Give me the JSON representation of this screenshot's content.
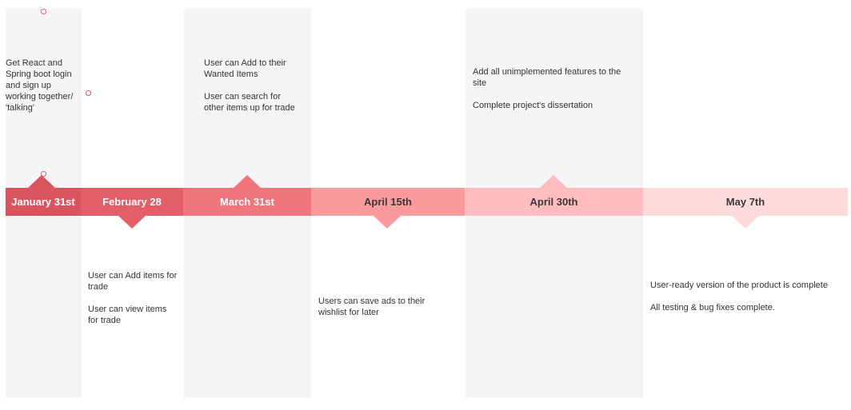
{
  "milestones": [
    {
      "label": "January 31st",
      "color": "#d9545e",
      "notes_above": [
        "Get React and Spring boot login and sign up working together/ 'talking'"
      ],
      "notes_below": []
    },
    {
      "label": "February 28",
      "color": "#e35f67",
      "notes_above": [],
      "notes_below": [
        "User can Add items for trade",
        "User can view items for trade"
      ]
    },
    {
      "label": "March 31st",
      "color": "#f0767b",
      "notes_above": [
        "User can Add to their Wanted Items",
        "User can search for other items up for trade"
      ],
      "notes_below": []
    },
    {
      "label": "April 15th",
      "color": "#fa9a9c",
      "notes_above": [],
      "notes_below": [
        "Users can save ads to their wishlist for later"
      ]
    },
    {
      "label": "April 30th",
      "color": "#fdbdbe",
      "notes_above": [
        "Add all unimplemented features to the site",
        "Complete project's dissertation"
      ],
      "notes_below": []
    },
    {
      "label": "May 7th",
      "color": "#fedadb",
      "notes_above": [],
      "notes_below": [
        "User-ready version of the product is complete",
        "All testing & bug fixes complete."
      ]
    }
  ],
  "colors": {
    "column_background": "#f5f5f7",
    "marker_outline": "#e0556a"
  }
}
